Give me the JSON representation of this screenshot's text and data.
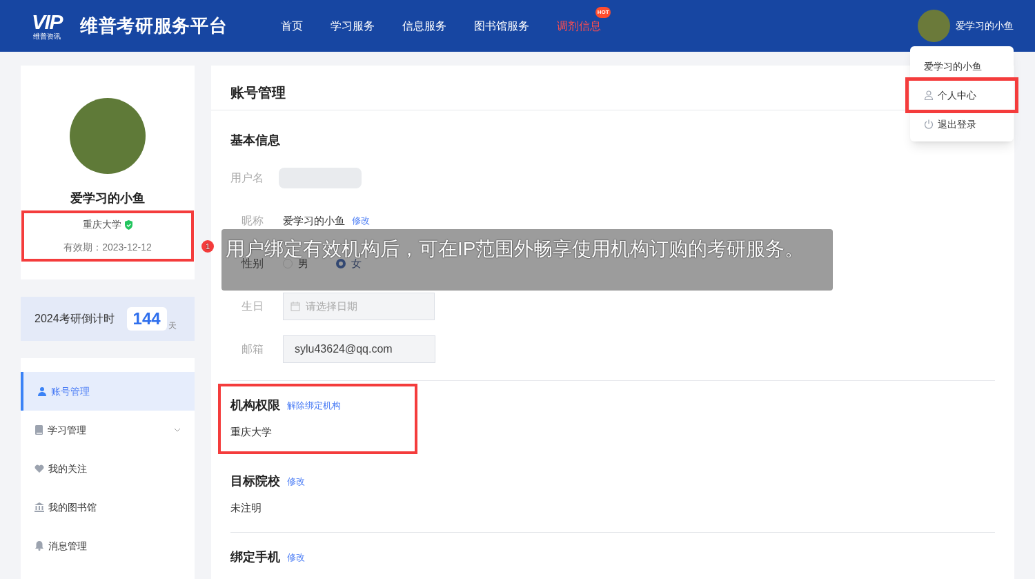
{
  "header": {
    "logo_mark": "VIP",
    "logo_sub": "维普资讯",
    "title": "维普考研服务平台",
    "nav": [
      {
        "label": "首页",
        "hot": false
      },
      {
        "label": "学习服务",
        "hot": false
      },
      {
        "label": "信息服务",
        "hot": false
      },
      {
        "label": "图书馆服务",
        "hot": false
      },
      {
        "label": "调剂信息",
        "hot": true,
        "badge": "HOT"
      }
    ],
    "user_name": "爱学习的小鱼"
  },
  "user_menu": [
    {
      "kind": "name",
      "label": "爱学习的小鱼",
      "highlighted": false
    },
    {
      "kind": "profile",
      "label": "个人中心",
      "highlighted": true
    },
    {
      "kind": "logout",
      "label": "退出登录",
      "highlighted": false
    }
  ],
  "profile": {
    "name": "爱学习的小鱼",
    "school": "重庆大学",
    "validity": "有效期：2023-12-12",
    "highlighted": true
  },
  "countdown": {
    "label": "2024考研倒计时",
    "days": "144",
    "unit": "天"
  },
  "side_menu": [
    {
      "kind": "user",
      "label": "账号管理",
      "selected": true,
      "expandable": false
    },
    {
      "kind": "book",
      "label": "学习管理",
      "selected": false,
      "expandable": true
    },
    {
      "kind": "heart",
      "label": "我的关注",
      "selected": false,
      "expandable": false
    },
    {
      "kind": "library",
      "label": "我的图书馆",
      "selected": false,
      "expandable": false
    },
    {
      "kind": "bell",
      "label": "消息管理",
      "selected": false,
      "expandable": false
    }
  ],
  "main": {
    "title": "账号管理",
    "basic_title": "基本信息",
    "fields": [
      {
        "kind": "blurred",
        "label": "用户名"
      },
      {
        "kind": "edit",
        "label": "昵称",
        "value": "爱学习的小鱼",
        "link": "修改"
      },
      {
        "kind": "radio",
        "label": "性别",
        "options": [
          {
            "label": "男",
            "selected": false
          },
          {
            "label": "女",
            "selected": true
          }
        ]
      },
      {
        "kind": "date",
        "label": "生日",
        "placeholder": "请选择日期"
      },
      {
        "kind": "input",
        "label": "邮箱",
        "value": "sylu43624@qq.com"
      }
    ],
    "sections": [
      {
        "title": "机构权限",
        "link": "解除绑定机构",
        "value": "重庆大学",
        "highlighted": true
      },
      {
        "title": "目标院校",
        "link": "修改",
        "value": "未注明",
        "highlighted": false
      },
      {
        "title": "绑定手机",
        "link": "修改",
        "highlighted": false
      }
    ]
  },
  "callout": {
    "number": "1",
    "text": "用户绑定有效机构后，可在IP范围外畅享使用机构订购的考研服务。"
  }
}
